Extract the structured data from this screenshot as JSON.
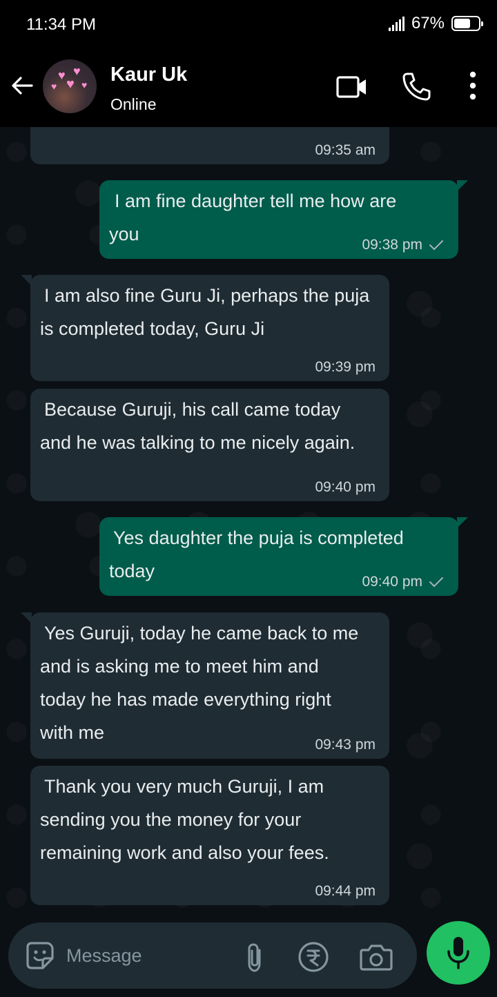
{
  "status_bar": {
    "time": "11:34 PM",
    "battery_percent": "67%",
    "battery_level": 0.67
  },
  "header": {
    "contact_name": "Kaur Uk",
    "presence": "Online"
  },
  "messages": [
    {
      "direction": "in",
      "text": "",
      "time": "09:35 am"
    },
    {
      "direction": "out",
      "text": "I am fine daughter tell me how are you",
      "time": "09:38 pm",
      "status_icon": "check-icon"
    },
    {
      "direction": "in",
      "text": "I am also fine Guru Ji, perhaps the puja is completed today, Guru Ji",
      "time": "09:39 pm"
    },
    {
      "direction": "in",
      "text": "Because Guruji, his call came today and he was talking to me nicely again.",
      "time": "09:40 pm"
    },
    {
      "direction": "out",
      "text": "Yes daughter the puja is completed today",
      "time": "09:40 pm",
      "status_icon": "check-icon"
    },
    {
      "direction": "in",
      "text": "Yes Guruji, today he came back to me and is asking me to meet him and today he has made everything right with me",
      "time": "09:43 pm"
    },
    {
      "direction": "in",
      "text": "Thank you very much Guruji, I am sending you the money for your remaining work and also your fees.",
      "time": "09:44 pm"
    }
  ],
  "composer": {
    "placeholder": "Message"
  },
  "colors": {
    "incoming_bubble": "#1f2c33",
    "outgoing_bubble": "#005c4b",
    "accent": "#21c063",
    "background": "#0b1014"
  }
}
